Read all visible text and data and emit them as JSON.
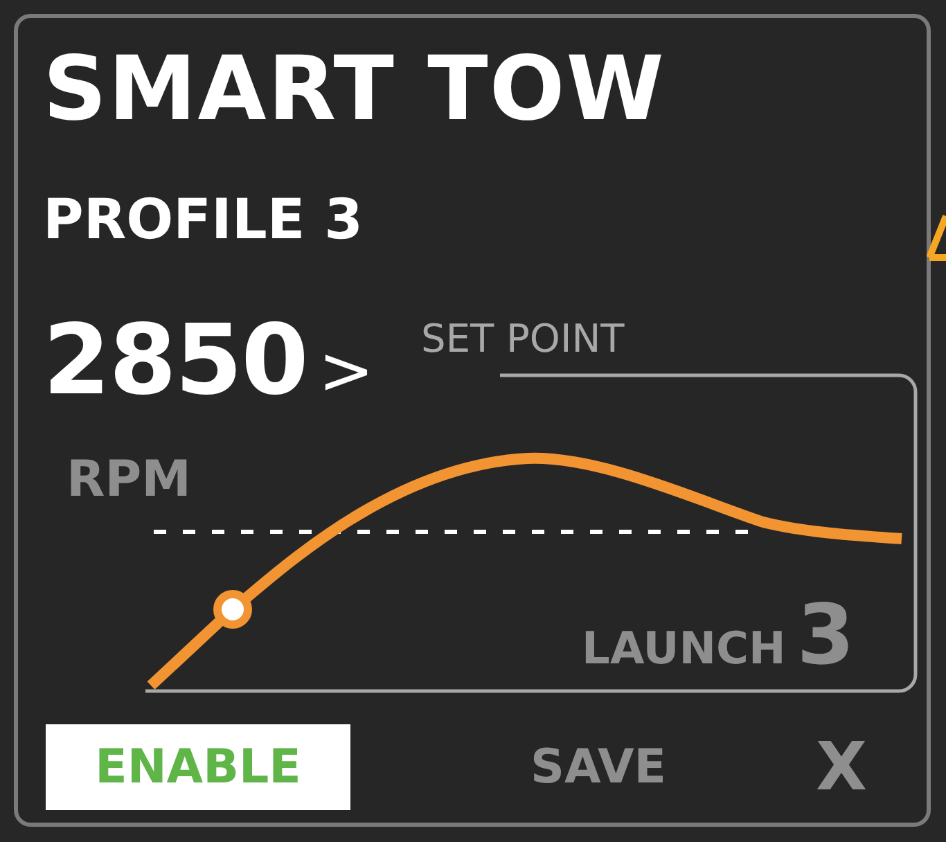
{
  "title": "SMART TOW",
  "profile": "PROFILE 3",
  "rpm": {
    "value": "2850",
    "arrow": ">",
    "unit": "RPM"
  },
  "set_point_label": "SET POINT",
  "launch": {
    "label": "LAUNCH",
    "value": "3"
  },
  "buttons": [
    {
      "label": "ENABLE",
      "kind": "primary",
      "on": true
    },
    {
      "label": "SAVE",
      "kind": "text",
      "on": false
    },
    {
      "label": "X",
      "kind": "close",
      "on": false
    }
  ]
}
